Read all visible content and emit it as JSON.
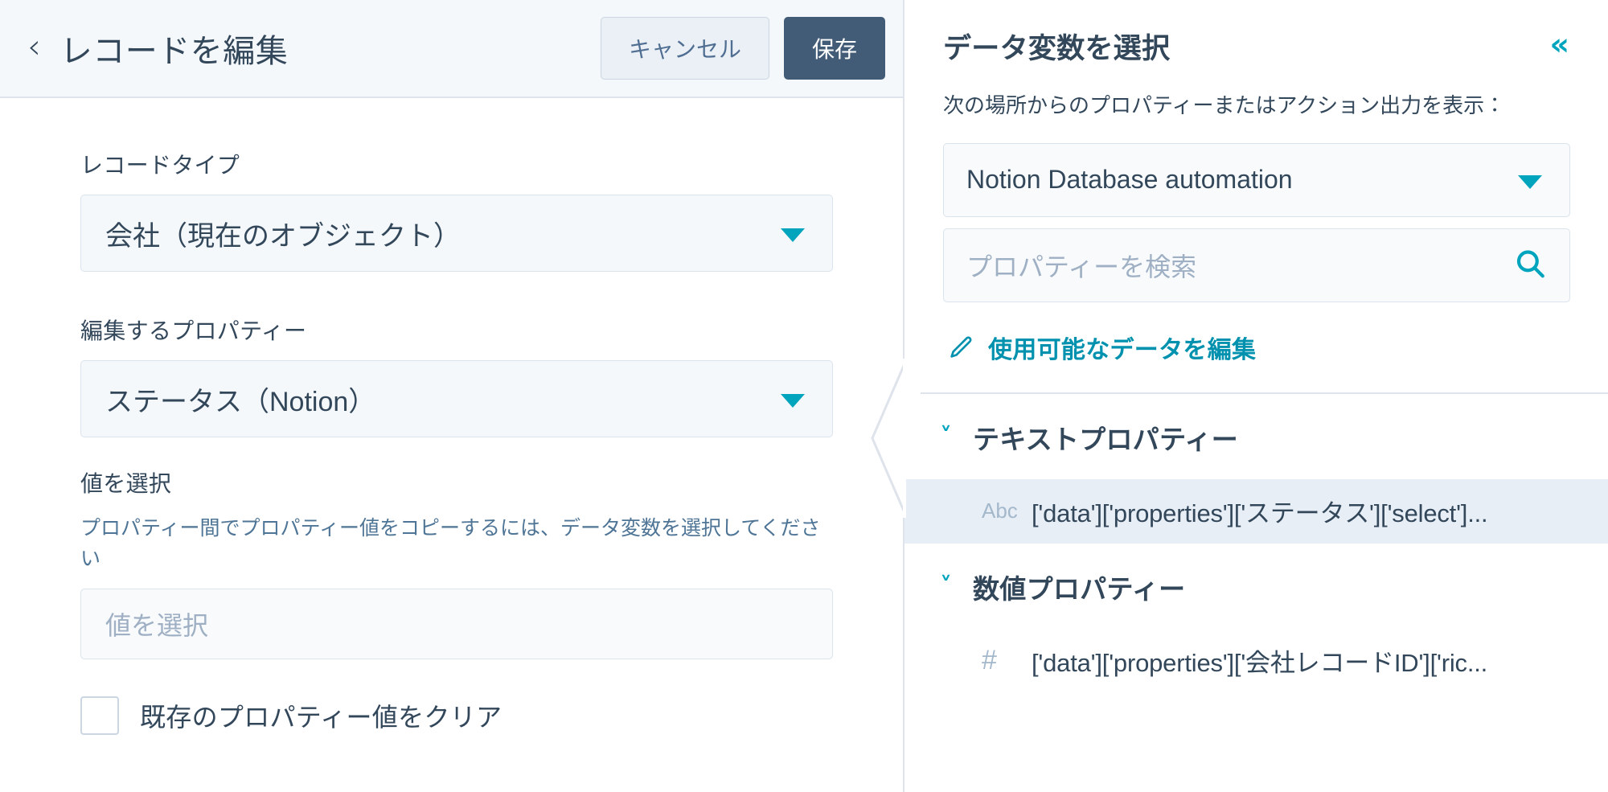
{
  "left": {
    "header": {
      "back_icon": "chevron-left-icon",
      "title": "レコードを編集",
      "cancel_label": "キャンセル",
      "save_label": "保存"
    },
    "fields": {
      "record_type": {
        "label": "レコードタイプ",
        "value": "会社（現在のオブジェクト）"
      },
      "property_to_edit": {
        "label": "編集するプロパティー",
        "value": "ステータス（Notion）"
      },
      "select_value": {
        "label": "値を選択",
        "help": "プロパティー間でプロパティー値をコピーするには、データ変数を選択してください",
        "placeholder": "値を選択"
      },
      "clear_checkbox": {
        "label": "既存のプロパティー値をクリア",
        "checked": false
      }
    }
  },
  "right": {
    "title": "データ変数を選択",
    "collapse_icon": "«",
    "description": "次の場所からのプロパティーまたはアクション出力を表示：",
    "source_select": {
      "value": "Notion Database automation"
    },
    "search": {
      "placeholder": "プロパティーを検索"
    },
    "edit_link": {
      "label": "使用可能なデータを編集"
    },
    "groups": [
      {
        "title": "テキストプロパティー",
        "expanded": true,
        "items": [
          {
            "type_icon": "Abc",
            "path": "['data']['properties']['ステータス']['select']...",
            "selected": true
          }
        ]
      },
      {
        "title": "数値プロパティー",
        "expanded": true,
        "items": [
          {
            "type_icon": "#",
            "path": "['data']['properties']['会社レコードID']['ric...",
            "selected": false
          }
        ]
      }
    ]
  },
  "colors": {
    "accent_teal": "#00a4bd",
    "link_teal": "#0091ae",
    "text_navy": "#33475b",
    "save_btn": "#425b76",
    "cancel_btn_bg": "#eaf0f6",
    "row_highlight": "#e8eef5",
    "field_bg": "#f5f8fa",
    "border": "#dfe3eb"
  }
}
